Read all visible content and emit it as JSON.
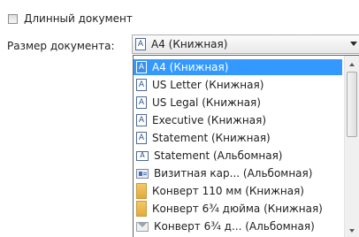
{
  "long_document": {
    "label": "Длинный документ",
    "checked": false
  },
  "size": {
    "label": "Размер документа:",
    "selected": "A4 (Книжная)",
    "options": [
      {
        "label": "A4 (Книжная)",
        "icon": "portrait-page-icon",
        "selected": true
      },
      {
        "label": "US Letter (Книжная)",
        "icon": "portrait-page-icon"
      },
      {
        "label": "US Legal (Книжная)",
        "icon": "portrait-page-icon"
      },
      {
        "label": "Executive (Книжная)",
        "icon": "portrait-page-icon"
      },
      {
        "label": "Statement (Книжная)",
        "icon": "portrait-page-icon"
      },
      {
        "label": "Statement (Альбомная)",
        "icon": "landscape-page-icon"
      },
      {
        "label": "Визитная кар... (Альбомная)",
        "icon": "business-card-icon"
      },
      {
        "label": "Конверт 110 мм (Книжная)",
        "icon": "envelope-portrait-icon"
      },
      {
        "label": "Конверт 6¾ дюйма (Книжная)",
        "icon": "envelope-portrait-icon"
      },
      {
        "label": "Конверт 6¾ д... (Альбомная)",
        "icon": "envelope-landscape-icon"
      }
    ]
  },
  "colors": {
    "selection": "#3399ff"
  }
}
